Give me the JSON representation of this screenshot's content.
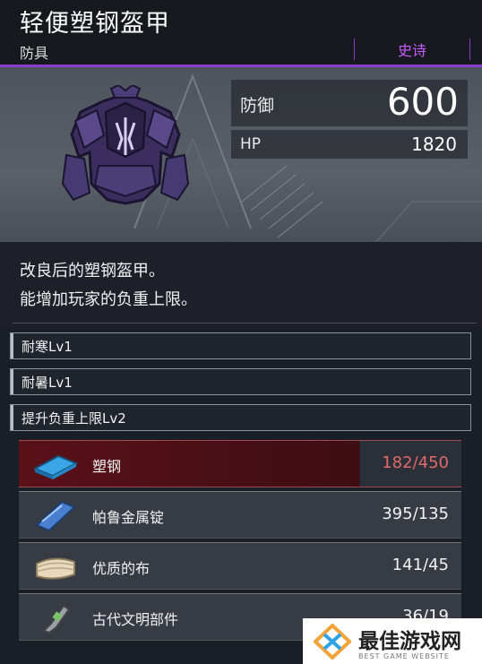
{
  "item": {
    "name": "轻便塑钢盔甲",
    "category": "防具",
    "rarity": "史诗",
    "rarity_color": "#c65bff",
    "description": [
      "改良后的塑钢盔甲。",
      "能增加玩家的负重上限。"
    ]
  },
  "stats": {
    "defense_label": "防御",
    "defense_value": "600",
    "hp_label": "HP",
    "hp_value": "1820"
  },
  "skills": [
    "耐寒Lv1",
    "耐暑Lv1",
    "提升负重上限Lv2"
  ],
  "materials": [
    {
      "name": "塑钢",
      "count": "182/450",
      "insufficient": true,
      "icon": "plasteel-icon"
    },
    {
      "name": "帕鲁金属锭",
      "count": "395/135",
      "insufficient": false,
      "icon": "pal-metal-ingot-icon"
    },
    {
      "name": "优质的布",
      "count": "141/45",
      "insufficient": false,
      "icon": "high-quality-cloth-icon"
    },
    {
      "name": "古代文明部件",
      "count": "36/19",
      "insufficient": false,
      "icon": "ancient-civilization-parts-icon"
    }
  ],
  "watermark": {
    "text": "最佳游戏网",
    "sub": "BEST GAME WEBSITE"
  }
}
